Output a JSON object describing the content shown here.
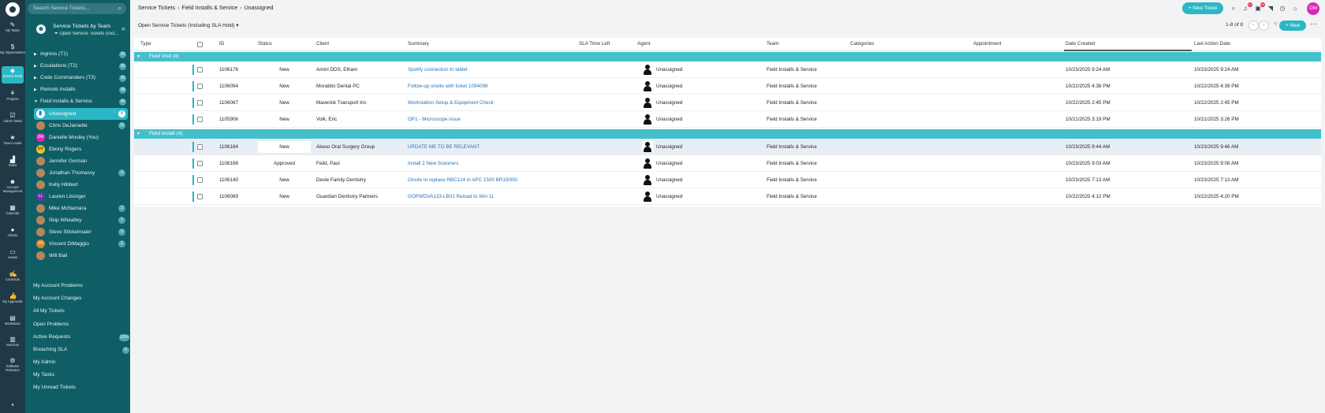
{
  "rail": {
    "items": [
      {
        "label": "My Tasks",
        "icon": "pin-icon"
      },
      {
        "label": "My Opportunities",
        "icon": "dollar-icon"
      },
      {
        "label": "Service Desk",
        "icon": "ticket-icon"
      },
      {
        "label": "Projects",
        "icon": "projects-icon"
      },
      {
        "label": "Admin Tasks",
        "icon": "checkbox-icon"
      },
      {
        "label": "Team Leads",
        "icon": "star-icon"
      },
      {
        "label": "Sales",
        "icon": "chart-icon"
      },
      {
        "label": "Account Management",
        "icon": "people-icon"
      },
      {
        "label": "Calendar",
        "icon": "calendar-icon"
      },
      {
        "label": "Clients",
        "icon": "person-icon"
      },
      {
        "label": "Assets",
        "icon": "monitor-icon"
      },
      {
        "label": "Contracts",
        "icon": "contract-icon"
      },
      {
        "label": "My Approvals",
        "icon": "thumbs-up-icon"
      },
      {
        "label": "Bookstack",
        "icon": "book-icon"
      },
      {
        "label": "Services",
        "icon": "services-icon"
      },
      {
        "label": "Software Releases",
        "icon": "software-icon"
      }
    ]
  },
  "panel": {
    "search_placeholder": "Search Service Tickets...",
    "team_title": "Service Tickets by Team",
    "team_subtitle": "Open Service Tickets (Incl...",
    "groups": [
      {
        "label": "Ingress (T1)",
        "count": "20",
        "caret": "▶"
      },
      {
        "label": "Escalations (T2)",
        "count": "36",
        "caret": "▶"
      },
      {
        "label": "Code Commanders (T3)",
        "count": "35",
        "caret": "▶"
      },
      {
        "label": "Remote Installs",
        "count": "38",
        "caret": "▶"
      },
      {
        "label": "Field Installs & Service",
        "count": "45",
        "caret": "▼"
      }
    ],
    "people": [
      {
        "name": "Unassigned",
        "count": "8",
        "initials": ""
      },
      {
        "name": "Chris DeJarnette",
        "count": "10",
        "initials": ""
      },
      {
        "name": "Danielle Mosley (You)",
        "count": "",
        "initials": "DM"
      },
      {
        "name": "Ebony Rogers",
        "count": "",
        "initials": "ER"
      },
      {
        "name": "Jennifer German",
        "count": "",
        "initials": ""
      },
      {
        "name": "Jonathan Thomassy",
        "count": "3",
        "initials": ""
      },
      {
        "name": "Kelly Hibbert",
        "count": "",
        "initials": ""
      },
      {
        "name": "Lauren Litsinger",
        "count": "",
        "initials": "LL"
      },
      {
        "name": "Mike McNamara",
        "count": "2",
        "initials": ""
      },
      {
        "name": "Skip Wheatley",
        "count": "1",
        "initials": ""
      },
      {
        "name": "Steve Stickelmaier",
        "count": "5",
        "initials": ""
      },
      {
        "name": "Vincent DiMaggio",
        "count": "2",
        "initials": "VD"
      },
      {
        "name": "Will Ball",
        "count": "",
        "initials": ""
      }
    ],
    "links": [
      {
        "label": "My Account Problems",
        "count": ""
      },
      {
        "label": "My Account Changes",
        "count": ""
      },
      {
        "label": "All My Tickets",
        "count": ""
      },
      {
        "label": "Open Problems",
        "count": ""
      },
      {
        "label": "Active Requests",
        "count": "1014"
      },
      {
        "label": "Breaching SLA",
        "count": "6"
      },
      {
        "label": "My Admin",
        "count": ""
      },
      {
        "label": "My Tasks",
        "count": ""
      },
      {
        "label": "My Unread Tickets",
        "count": ""
      }
    ]
  },
  "topbar": {
    "breadcrumb": [
      "Service Tickets",
      "Field Installs & Service",
      "Unassigned"
    ],
    "new_ticket": "+ New Ticket",
    "badge1": "12",
    "badge2": "50",
    "user_initials": "DM"
  },
  "subbar": {
    "view": "Open Service Tickets (Including SLA Hold)",
    "pager": "1-8 of 8",
    "new_label": "+ New"
  },
  "grid": {
    "headers": [
      "Type",
      "ID",
      "Status",
      "Client",
      "Summary",
      "SLA Time Left",
      "Agent",
      "Team",
      "Categories",
      "Appointment",
      "Date Created",
      "Last Action Date"
    ],
    "groups": [
      {
        "title": "Field Visit (4)",
        "rows": [
          {
            "id": "1106176",
            "status": "New",
            "client": "Amini DDS, Elham",
            "summary": "Spotify connection to tablet",
            "agent": "Unassigned",
            "team": "Field Installs & Service",
            "created": "10/23/2025 9:24 AM",
            "last": "10/23/2025 9:24 AM"
          },
          {
            "id": "1106094",
            "status": "New",
            "client": "Morabito Dental PC",
            "summary": "Follow-up onsite with ticket 1094096",
            "agent": "Unassigned",
            "team": "Field Installs & Service",
            "created": "10/22/2025 4:38 PM",
            "last": "10/22/2025 4:39 PM"
          },
          {
            "id": "1106067",
            "status": "New",
            "client": "Maverick Transport Inc",
            "summary": "Workstation Setup & Equipment Check",
            "agent": "Unassigned",
            "team": "Field Installs & Service",
            "created": "10/22/2025 2:45 PM",
            "last": "10/22/2025 2:45 PM"
          },
          {
            "id": "1105906",
            "status": "New",
            "client": "Volk, Eric",
            "summary": "OP1 - Microscope issue",
            "agent": "Unassigned",
            "team": "Field Installs & Service",
            "created": "10/21/2025 3:19 PM",
            "last": "10/21/2025 3:26 PM"
          }
        ]
      },
      {
        "title": "Field Install (4)",
        "rows": [
          {
            "id": "1106184",
            "status": "New",
            "client": "Akeso Oral Surgery Group",
            "summary": "UPDATE ME TO BE RELEVANT",
            "agent": "Unassigned",
            "team": "Field Installs & Service",
            "created": "10/23/2025 9:44 AM",
            "last": "10/23/2025 9:46 AM"
          },
          {
            "id": "1106168",
            "status": "Approved",
            "client": "Feild, Paul",
            "summary": "Install 2 New Scanners",
            "agent": "Unassigned",
            "team": "Field Installs & Service",
            "created": "10/23/2025 9:03 AM",
            "last": "10/23/2025 9:08 AM"
          },
          {
            "id": "1106140",
            "status": "New",
            "client": "Devle Family Dentistry",
            "summary": "Onsite to replace RBC124 in APC 1500 BR1500G",
            "agent": "Unassigned",
            "team": "Field Installs & Service",
            "created": "10/23/2025 7:13 AM",
            "last": "10/23/2025 7:13 AM"
          },
          {
            "id": "1106089",
            "status": "New",
            "client": "Guardian Dentistry Partners",
            "summary": "GOPWDVA133-LB01 Reload to Win 11",
            "agent": "Unassigned",
            "team": "Field Installs & Service",
            "created": "10/22/2025 4:12 PM",
            "last": "10/22/2025 4:20 PM"
          }
        ]
      }
    ]
  }
}
